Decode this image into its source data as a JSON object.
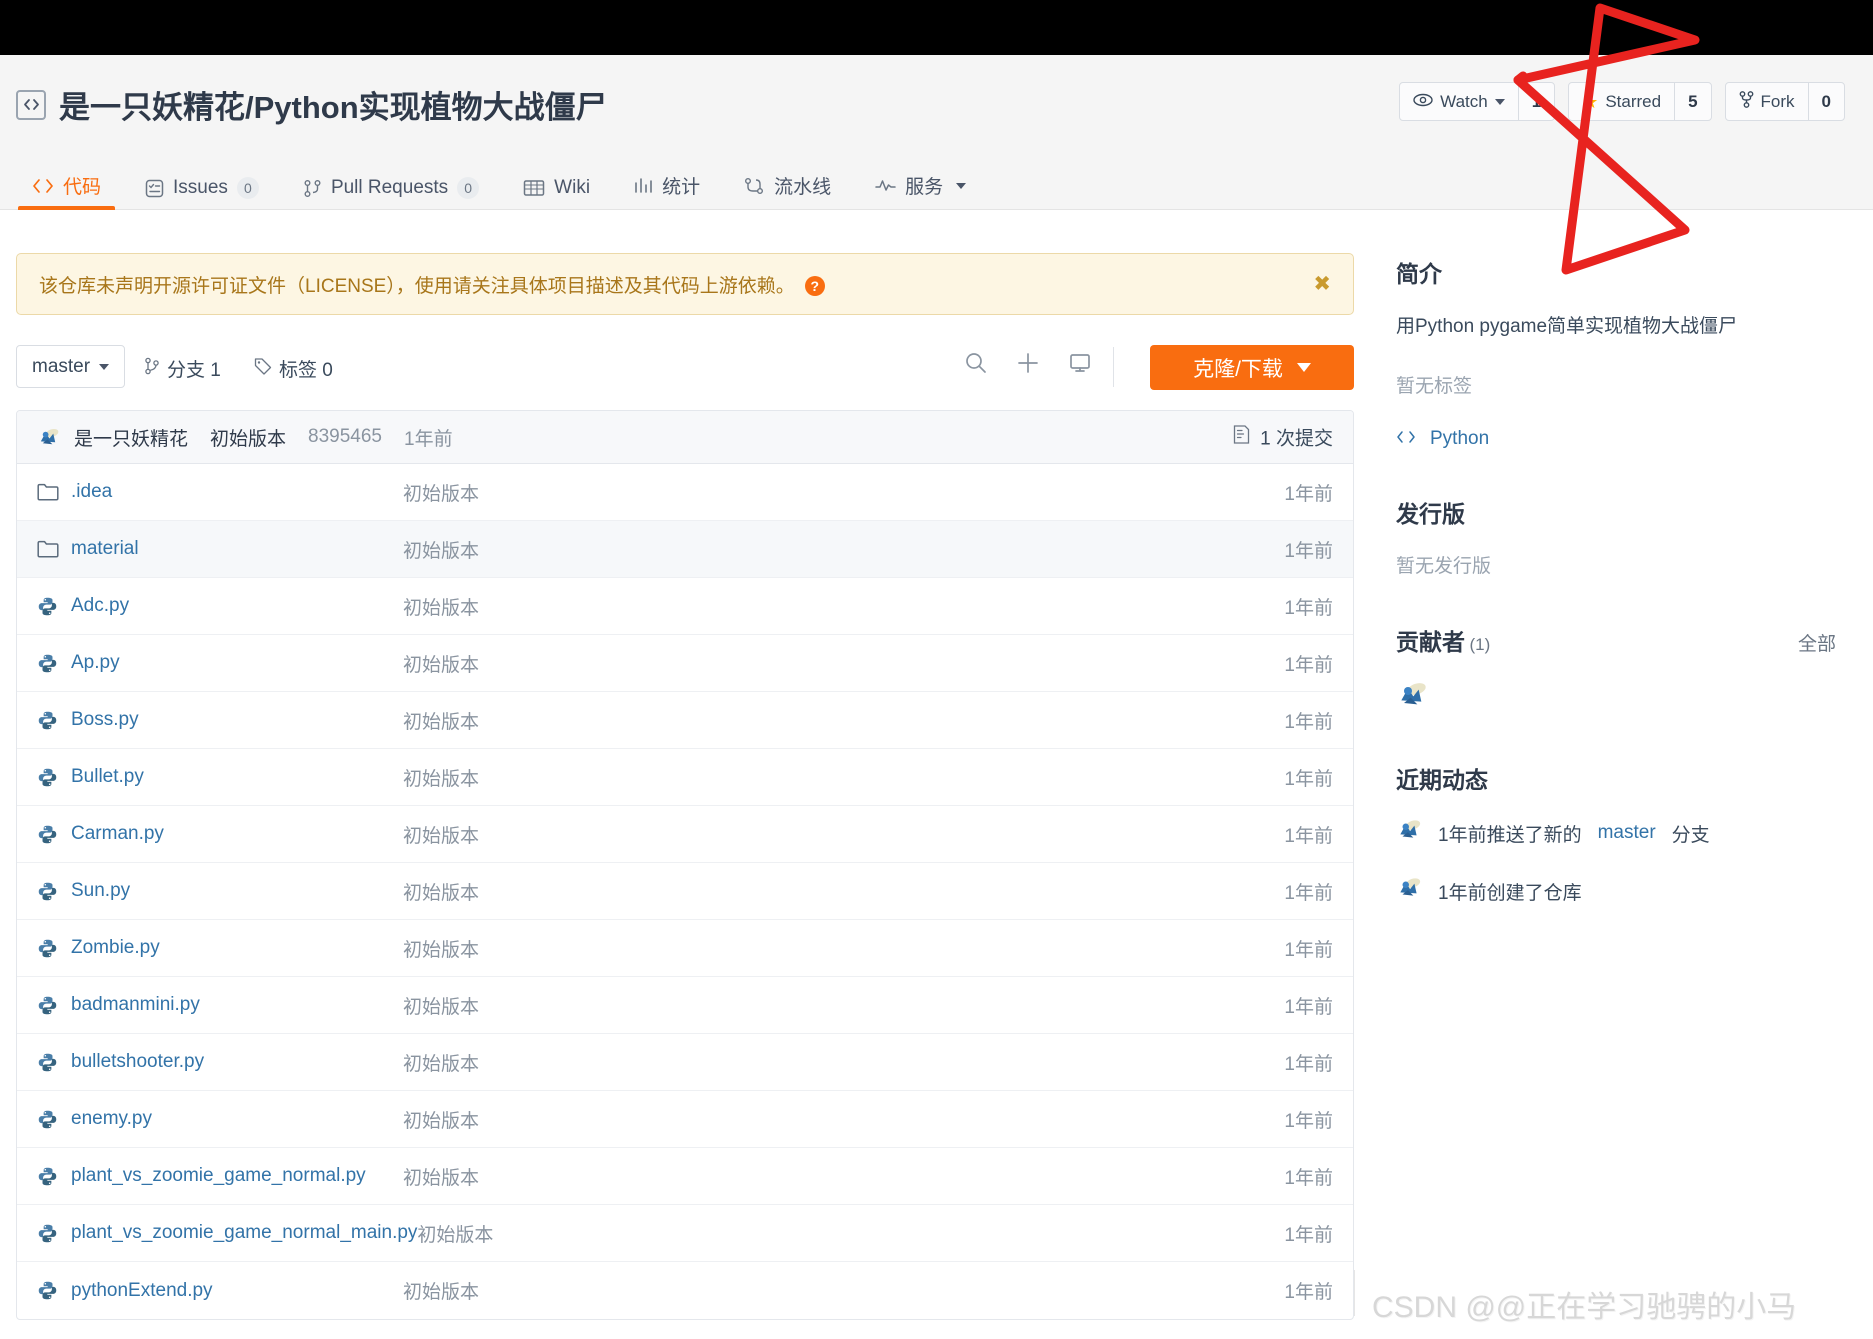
{
  "header": {
    "repo_icon": "repo-code-icon",
    "title": "是一只妖精花/Python实现植物大战僵尸",
    "actions": [
      {
        "icon": "eye-icon",
        "label": "Watch",
        "has_caret": true,
        "count": "1"
      },
      {
        "icon": "star-icon",
        "label": "Starred",
        "has_caret": false,
        "count": "5"
      },
      {
        "icon": "fork-icon",
        "label": "Fork",
        "has_caret": false,
        "count": "0"
      }
    ]
  },
  "tabs": [
    {
      "icon": "code-icon",
      "label": "代码",
      "badge": null,
      "active": true,
      "caret": false
    },
    {
      "icon": "issues-icon",
      "label": "Issues",
      "badge": "0",
      "active": false,
      "caret": false
    },
    {
      "icon": "pull-request-icon",
      "label": "Pull Requests",
      "badge": "0",
      "active": false,
      "caret": false
    },
    {
      "icon": "wiki-icon",
      "label": "Wiki",
      "badge": null,
      "active": false,
      "caret": false
    },
    {
      "icon": "stats-icon",
      "label": "统计",
      "badge": null,
      "active": false,
      "caret": false
    },
    {
      "icon": "pipeline-icon",
      "label": "流水线",
      "badge": null,
      "active": false,
      "caret": false
    },
    {
      "icon": "service-icon",
      "label": "服务",
      "badge": null,
      "active": false,
      "caret": true
    }
  ],
  "notice": {
    "text": "该仓库未声明开源许可证文件（LICENSE），使用请关注具体项目描述及其代码上游依赖。",
    "help_icon": "question-mark-icon",
    "close_icon": "close-icon"
  },
  "toolbar": {
    "branch": "master",
    "branches_label": "分支 1",
    "tags_label": "标签 0",
    "icons": [
      "search-icon",
      "plus-icon",
      "monitor-icon"
    ],
    "clone_label": "克隆/下载"
  },
  "commit_bar": {
    "avatar": "user-avatar",
    "author": "是一只妖精花",
    "message": "初始版本",
    "sha": "8395465",
    "time": "1年前",
    "commits_icon": "commit-history-icon",
    "commits_label": "1 次提交"
  },
  "files": [
    {
      "icon": "folder-icon",
      "name": ".idea",
      "message": "初始版本",
      "time": "1年前",
      "hover": false
    },
    {
      "icon": "folder-icon",
      "name": "material",
      "message": "初始版本",
      "time": "1年前",
      "hover": true
    },
    {
      "icon": "python-file-icon",
      "name": "Adc.py",
      "message": "初始版本",
      "time": "1年前",
      "hover": false
    },
    {
      "icon": "python-file-icon",
      "name": "Ap.py",
      "message": "初始版本",
      "time": "1年前",
      "hover": false
    },
    {
      "icon": "python-file-icon",
      "name": "Boss.py",
      "message": "初始版本",
      "time": "1年前",
      "hover": false
    },
    {
      "icon": "python-file-icon",
      "name": "Bullet.py",
      "message": "初始版本",
      "time": "1年前",
      "hover": false
    },
    {
      "icon": "python-file-icon",
      "name": "Carman.py",
      "message": "初始版本",
      "time": "1年前",
      "hover": false
    },
    {
      "icon": "python-file-icon",
      "name": "Sun.py",
      "message": "初始版本",
      "time": "1年前",
      "hover": false
    },
    {
      "icon": "python-file-icon",
      "name": "Zombie.py",
      "message": "初始版本",
      "time": "1年前",
      "hover": false
    },
    {
      "icon": "python-file-icon",
      "name": "badmanmini.py",
      "message": "初始版本",
      "time": "1年前",
      "hover": false
    },
    {
      "icon": "python-file-icon",
      "name": "bulletshooter.py",
      "message": "初始版本",
      "time": "1年前",
      "hover": false
    },
    {
      "icon": "python-file-icon",
      "name": "enemy.py",
      "message": "初始版本",
      "time": "1年前",
      "hover": false
    },
    {
      "icon": "python-file-icon",
      "name": "plant_vs_zoomie_game_normal.py",
      "message": "初始版本",
      "time": "1年前",
      "hover": false
    },
    {
      "icon": "python-file-icon",
      "name": "plant_vs_zoomie_game_normal_main.py",
      "message": "初始版本",
      "time": "1年前",
      "hover": false
    },
    {
      "icon": "python-file-icon",
      "name": "pythonExtend.py",
      "message": "初始版本",
      "time": "1年前",
      "hover": false
    }
  ],
  "sidebar": {
    "about_title": "简介",
    "about_desc": "用Python pygame简单实现植物大战僵尸",
    "no_tags": "暂无标签",
    "lang_icon": "code-brackets-icon",
    "lang": "Python",
    "release_title": "发行版",
    "no_release": "暂无发行版",
    "contributors_title": "贡献者",
    "contributors_count": "(1)",
    "contributors_all": "全部",
    "activity_title": "近期动态",
    "activities": [
      {
        "avatar": "user-avatar",
        "prefix": "1年前推送了新的",
        "link": "master",
        "suffix": "分支"
      },
      {
        "avatar": "user-avatar",
        "prefix": "1年前创建了仓库",
        "link": "",
        "suffix": ""
      }
    ]
  },
  "annotation": {
    "shape": "red-star-scribble",
    "color": "#e8231f"
  },
  "watermark": "CSDN @@正在学习驰骋的小马",
  "colors": {
    "accent": "#f96d10",
    "link": "#3273a8",
    "notice_bg": "#fdf6e3",
    "notice_text": "#a8761a",
    "star": "#ffb300",
    "annotation": "#e8231f"
  }
}
